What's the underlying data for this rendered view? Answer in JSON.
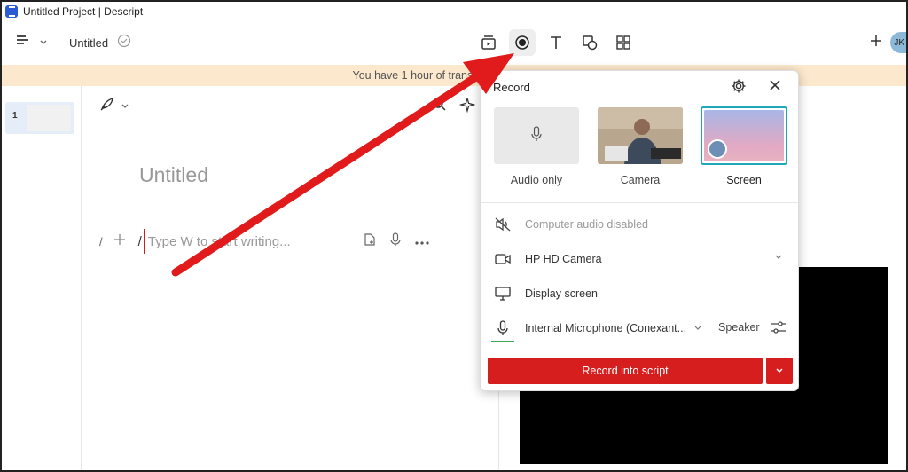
{
  "window": {
    "title": "Untitled Project | Descript"
  },
  "toolbar": {
    "doc_title": "Untitled",
    "avatar_initials": "JK"
  },
  "banner": {
    "text": "You have 1 hour of transcri"
  },
  "sidebar": {
    "scene_number": "1"
  },
  "editor": {
    "title": "Untitled",
    "prefix": "/",
    "slash": "/",
    "placeholder": "Type W to start writing..."
  },
  "record_panel": {
    "title": "Record",
    "modes": [
      {
        "label": "Audio only",
        "icon": "microphone-icon"
      },
      {
        "label": "Camera",
        "icon": "camera-thumbnail"
      },
      {
        "label": "Screen",
        "icon": "screen-thumbnail",
        "selected": true
      }
    ],
    "options": {
      "computer_audio": "Computer audio disabled",
      "camera": "HP HD Camera",
      "display": "Display screen",
      "microphone": "Internal Microphone (Conexant...",
      "speaker": "Speaker"
    },
    "record_button": "Record into script"
  },
  "colors": {
    "accent_red": "#d71e1e",
    "selected_teal": "#20a8b8",
    "banner_bg": "#fce8cc",
    "mic_level": "#3aa655"
  }
}
